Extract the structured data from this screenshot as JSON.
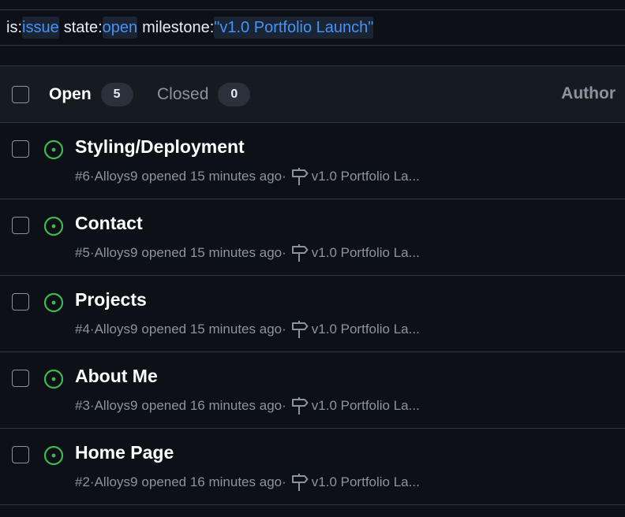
{
  "filter": {
    "tokens": [
      {
        "key": "is:",
        "value": "issue"
      },
      {
        "key": "state:",
        "value": "open"
      },
      {
        "key": "milestone:",
        "value": "\"v1.0 Portfolio Launch\""
      }
    ]
  },
  "header": {
    "open_label": "Open",
    "open_count": "5",
    "closed_label": "Closed",
    "closed_count": "0",
    "author_label": "Author"
  },
  "issues": [
    {
      "title": "Styling/Deployment",
      "number": "#6",
      "author": "Alloys9",
      "opened": "opened 15 minutes ago",
      "milestone": "v1.0 Portfolio La..."
    },
    {
      "title": "Contact",
      "number": "#5",
      "author": "Alloys9",
      "opened": "opened 15 minutes ago",
      "milestone": "v1.0 Portfolio La..."
    },
    {
      "title": "Projects",
      "number": "#4",
      "author": "Alloys9",
      "opened": "opened 15 minutes ago",
      "milestone": "v1.0 Portfolio La..."
    },
    {
      "title": "About Me",
      "number": "#3",
      "author": "Alloys9",
      "opened": "opened 16 minutes ago",
      "milestone": "v1.0 Portfolio La..."
    },
    {
      "title": "Home Page",
      "number": "#2",
      "author": "Alloys9",
      "opened": "opened 16 minutes ago",
      "milestone": "v1.0 Portfolio La..."
    }
  ],
  "separator": " · ",
  "icons": {
    "issue_open": "issue-opened-icon",
    "milestone": "milestone-icon"
  },
  "colors": {
    "background": "#0d1117",
    "header_bg": "#161b22",
    "border": "#30363d",
    "open_green": "#3fb950",
    "link_blue": "#4493f8",
    "muted": "#8b949e"
  }
}
